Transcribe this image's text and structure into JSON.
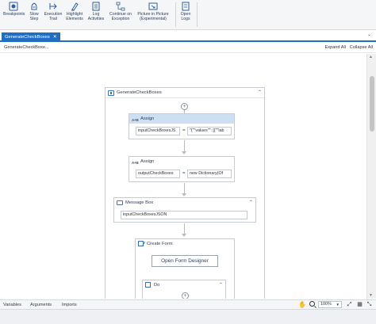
{
  "ribbon": {
    "buttons": [
      {
        "label_lines": [
          "Breakpoints"
        ],
        "icon": "breakpoint-icon"
      },
      {
        "label_lines": [
          "Slow",
          "Step"
        ],
        "icon": "slow-step-icon"
      },
      {
        "label_lines": [
          "Execution",
          "Trail"
        ],
        "icon": "execution-trail-icon"
      },
      {
        "label_lines": [
          "Highlight",
          "Elements"
        ],
        "icon": "highlight-icon"
      },
      {
        "label_lines": [
          "Log",
          "Activities"
        ],
        "icon": "log-icon"
      },
      {
        "label_lines": [
          "Continue on",
          "Exception"
        ],
        "icon": "continue-icon"
      },
      {
        "label_lines": [
          "Picture in Picture",
          "(Experimental)"
        ],
        "icon": "pip-icon"
      },
      {
        "label_lines": [
          "Open",
          "Logs"
        ],
        "icon": "open-logs-icon"
      }
    ]
  },
  "tab": {
    "title": "GenerateCheckBoxes",
    "close": "✕"
  },
  "breadcrumb": {
    "path": "GenerateCheckBoxe...",
    "expand_all": "Expand All",
    "collapse_all": "Collapse All"
  },
  "sequence": {
    "title": "GenerateCheckBoxes",
    "collapse_glyph": "⌃"
  },
  "assign1": {
    "title": "Assign",
    "to": "inputCheckBoxesJS",
    "value": "\"{\"\"values\"\": [{\"\"lab"
  },
  "assign2": {
    "title": "Assign",
    "to": "outputCheckBoxes",
    "value": "new Dictionary(Of"
  },
  "message_box": {
    "title": "Message Box",
    "text": "inputCheckBoxesJSON"
  },
  "create_form": {
    "title": "Create Form",
    "button": "Open Form Designer"
  },
  "do_block": {
    "title": "Do"
  },
  "bottom": {
    "tabs": [
      "Variables",
      "Arguments",
      "Imports"
    ],
    "zoom": "100%"
  },
  "colors": {
    "accent": "#1f6ec1",
    "selected_header": "#cde0f3"
  }
}
